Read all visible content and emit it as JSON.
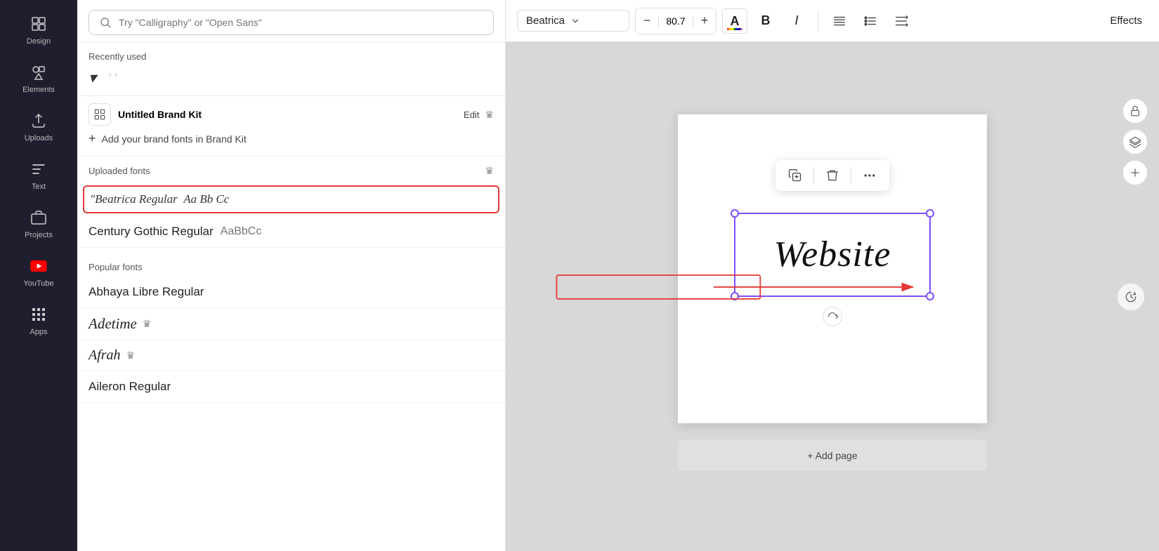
{
  "sidebar": {
    "items": [
      {
        "id": "design",
        "label": "Design",
        "icon": "design"
      },
      {
        "id": "elements",
        "label": "Elements",
        "icon": "elements"
      },
      {
        "id": "uploads",
        "label": "Uploads",
        "icon": "uploads"
      },
      {
        "id": "text",
        "label": "Text",
        "icon": "text"
      },
      {
        "id": "projects",
        "label": "Projects",
        "icon": "projects"
      },
      {
        "id": "youtube",
        "label": "YouTube",
        "icon": "youtube"
      },
      {
        "id": "apps",
        "label": "Apps",
        "icon": "apps"
      }
    ]
  },
  "font_panel": {
    "search_placeholder": "Try \"Calligraphy\" or \"Open Sans\"",
    "recently_used_label": "Recently used",
    "brand_kit_label": "Untitled Brand Kit",
    "edit_label": "Edit",
    "add_brand_label": "Add your brand fonts in Brand Kit",
    "uploaded_fonts_label": "Uploaded fonts",
    "fonts": {
      "uploaded": [
        {
          "id": "beatrica",
          "display": "Beatrica Regular",
          "preview": "Aa Bb Cc",
          "selected": true
        },
        {
          "id": "century_gothic",
          "display": "Century Gothic Regular",
          "preview": "AaBbCc",
          "selected": false
        }
      ],
      "popular": [
        {
          "id": "abhaya",
          "display": "Abhaya Libre Regular",
          "preview": "",
          "premium": false
        },
        {
          "id": "adetime",
          "display": "Adetime",
          "preview": "",
          "premium": true
        },
        {
          "id": "afrah",
          "display": "Afrah",
          "preview": "",
          "premium": true
        },
        {
          "id": "aileron",
          "display": "Aileron Regular",
          "preview": "",
          "premium": false
        }
      ],
      "popular_label": "Popular fonts"
    }
  },
  "toolbar": {
    "font_name": "Beatrica",
    "font_size": "80.7",
    "decrease_label": "−",
    "increase_label": "+",
    "bold_label": "B",
    "italic_label": "I",
    "effects_label": "Effects"
  },
  "canvas": {
    "text_content": "Website",
    "add_page_label": "+ Add page",
    "float_toolbar": {
      "copy_icon": "copy",
      "delete_icon": "delete",
      "more_icon": "more"
    }
  },
  "right_panel": {
    "lock_icon": "lock",
    "layers_icon": "layers",
    "add_icon": "add"
  }
}
